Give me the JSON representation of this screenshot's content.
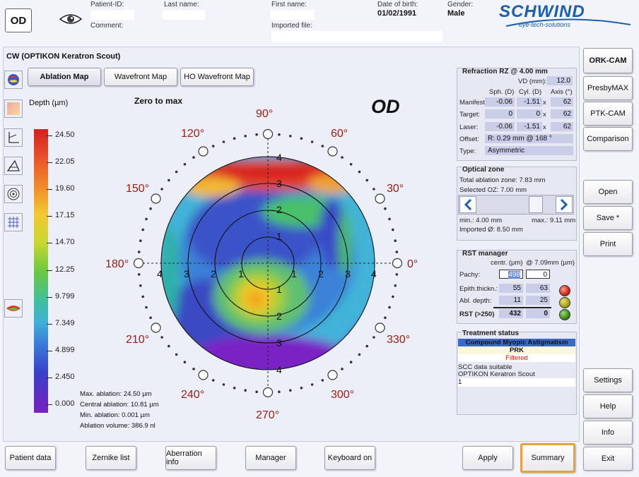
{
  "header": {
    "eye": "OD",
    "patient_id_label": "Patient-ID:",
    "last_name_label": "Last name:",
    "first_name_label": "First name:",
    "dob_label": "Date of birth:",
    "dob_value": "01/02/1991",
    "gender_label": "Gender:",
    "gender_value": "Male",
    "comment_label": "Comment:",
    "imported_file_label": "Imported file:",
    "brand": "SCHWIND",
    "brand_tagline": "eye-tech-solutions"
  },
  "section_title": "CW (OPTIKON Keratron Scout)",
  "tabs": [
    "Ablation Map",
    "Wavefront Map",
    "HO Wavefront Map"
  ],
  "map": {
    "depth_label": "Depth (µm)",
    "mode_label": "Zero to max",
    "eye_label": "OD",
    "scale_values": [
      "24.50",
      "22.05",
      "19.60",
      "17.15",
      "14.70",
      "12.25",
      "9.799",
      "7.349",
      "4.899",
      "2.450",
      "0.000"
    ],
    "angles": {
      "a90": "90°",
      "a120": "120°",
      "a60": "60°",
      "a150": "150°",
      "a30": "30°",
      "a180": "180°",
      "a0": "0°",
      "a210": "210°",
      "a330": "330°",
      "a240": "240°",
      "a300": "300°",
      "a270": "270°"
    },
    "ring_numbers": [
      "1",
      "2",
      "3",
      "4"
    ],
    "stats": {
      "max": "Max. ablation: 24.50 µm",
      "central": "Central ablation: 10.81 µm",
      "min": "Min. ablation: 0.001 µm",
      "volume": "Ablation volume: 386.9 nl"
    }
  },
  "refraction": {
    "title": "Refraction RZ @ 4.00 mm",
    "vd_label": "VD (mm):",
    "vd_value": "12.0",
    "col_sph": "Sph. (D)",
    "col_cyl": "Cyl. (D)",
    "col_axis": "Axis (°)",
    "rows": [
      {
        "label": "Manifest:",
        "sph": "-0.06",
        "cyl": "-1.51",
        "axis": "62"
      },
      {
        "label": "Target:",
        "sph": "0",
        "cyl": "0",
        "axis": "62"
      },
      {
        "label": "Laser:",
        "sph": "-0.06",
        "cyl": "-1.51",
        "axis": "62"
      }
    ],
    "x": "x",
    "offset_label": "Offset:",
    "offset_value": "R: 0.29 mm @ 168 °",
    "type_label": "Type:",
    "type_value": "Asymmetric"
  },
  "optical_zone": {
    "title": "Optical zone",
    "total": "Total ablation zone: 7.83 mm",
    "selected": "Selected OZ: 7.00 mm",
    "min": "min.: 4.00 mm",
    "max": "max.: 9.11 mm",
    "imported": "Imported Ø: 8.50 mm",
    "slider_level": 0.8
  },
  "rst": {
    "title": "RST manager",
    "col_centr": "centr. (µm)",
    "col_at": "@ 7.09mm (µm)",
    "rows": [
      {
        "label": "Pachy:",
        "c": "498",
        "p": "0"
      },
      {
        "label": "Epith.thickn.:",
        "c": "55",
        "p": "63"
      },
      {
        "label": "Abl. depth:",
        "c": "11",
        "p": "25"
      },
      {
        "label": "RST (>250)",
        "c": "432",
        "p": "0"
      }
    ],
    "lights": [
      "#cc2a1a",
      "#a9a318",
      "#3b8a19"
    ]
  },
  "treatment": {
    "title": "Treatment status",
    "type": "Compound Myopic Astigmatism",
    "method": "PRK",
    "filtered": "Filtered",
    "line1": "SCC data suitable",
    "line2": "OPTIKON Keratron Scout",
    "line3": "1"
  },
  "right_buttons": {
    "orkcam": "ORK-CAM",
    "presbymax": "PresbyMAX",
    "ptkcam": "PTK-CAM",
    "comparison": "Comparison",
    "open": "Open",
    "save": "Save *",
    "print": "Print",
    "settings": "Settings",
    "help": "Help",
    "info": "Info",
    "exit": "Exit"
  },
  "bottom_buttons": {
    "patient": "Patient data",
    "zernike": "Zernike list",
    "aberration": "Aberration info",
    "manager": "Manager",
    "keyboard": "Keyboard on",
    "apply": "Apply",
    "summary": "Summary"
  },
  "colors": {
    "accent": "#1a5eb0",
    "angle": "#9b1d12",
    "panel": "#c9cde8",
    "highlight_border": "#e8a03a"
  }
}
